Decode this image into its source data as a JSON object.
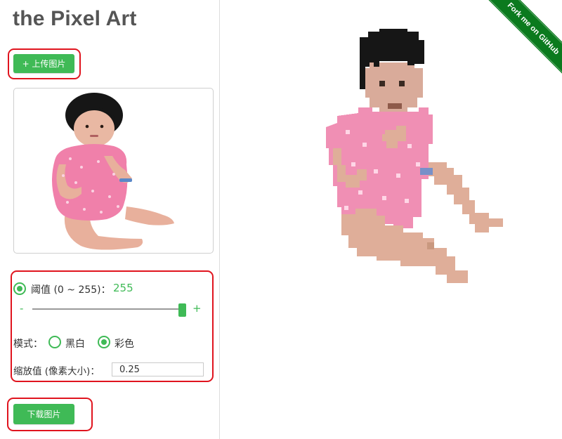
{
  "app": {
    "title": "the Pixel Art"
  },
  "upload_button": {
    "label": "+ 上传图片"
  },
  "threshold": {
    "label": "阈值 (0 ~ 255)：",
    "value": "255",
    "min_symbol": "-",
    "max_symbol": "+",
    "level": 1.0,
    "enabled": true
  },
  "mode": {
    "label": "模式：",
    "options": [
      "黑白",
      "彩色"
    ],
    "selected": "彩色"
  },
  "scale": {
    "label": "缩放值 (像素大小)：",
    "value": "0.25"
  },
  "download_button": {
    "label": "下载图片"
  },
  "ribbon": {
    "label": "Fork me on GitHub"
  },
  "colors": {
    "accent": "#3fba56",
    "highlight": "#e0141e",
    "ribbon": "#0b7a1e",
    "title": "#555555"
  },
  "icons": [
    "radio-checked-icon",
    "radio-unchecked-icon"
  ]
}
